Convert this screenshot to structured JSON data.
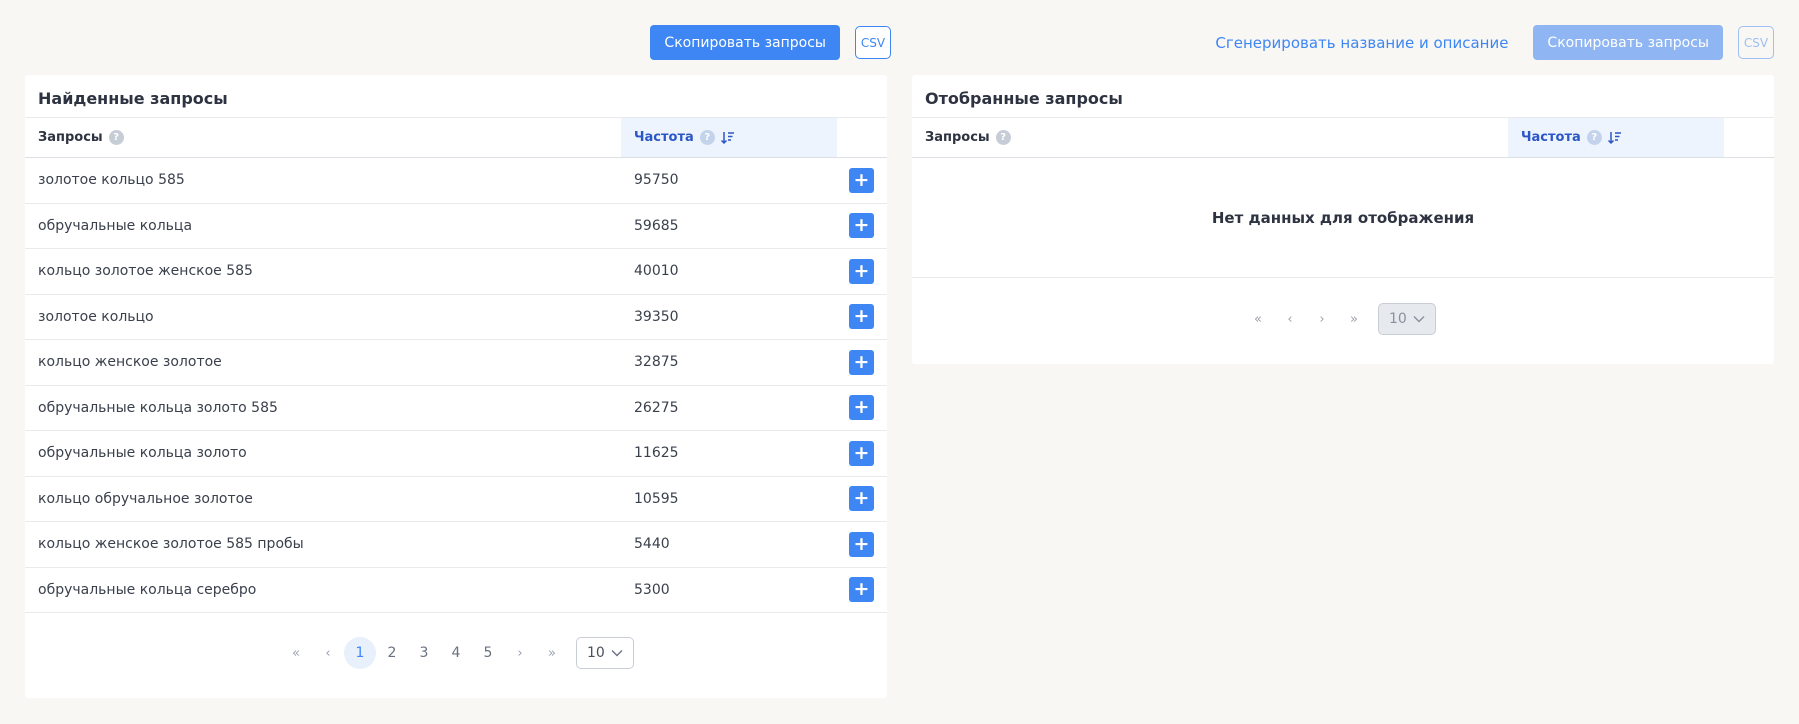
{
  "left_toolbar": {
    "copy_label": "Скопировать запросы",
    "csv_label": "CSV"
  },
  "right_toolbar": {
    "generate_label": "Сгенерировать название и описание",
    "copy_label": "Скопировать запросы",
    "csv_label": "CSV"
  },
  "found": {
    "title": "Найденные запросы",
    "col_query": "Запросы",
    "col_freq": "Частота",
    "rows": [
      {
        "q": "золотое кольцо 585",
        "f": "95750"
      },
      {
        "q": "обручальные кольца",
        "f": "59685"
      },
      {
        "q": "кольцо золотое женское 585",
        "f": "40010"
      },
      {
        "q": "золотое кольцо",
        "f": "39350"
      },
      {
        "q": "кольцо женское золотое",
        "f": "32875"
      },
      {
        "q": "обручальные кольца золото 585",
        "f": "26275"
      },
      {
        "q": "обручальные кольца золото",
        "f": "11625"
      },
      {
        "q": "кольцо обручальное золотое",
        "f": "10595"
      },
      {
        "q": "кольцо женское золотое 585 пробы",
        "f": "5440"
      },
      {
        "q": "обручальные кольца серебро",
        "f": "5300"
      }
    ],
    "pager": {
      "first": "«",
      "prev": "‹",
      "pages": [
        "1",
        "2",
        "3",
        "4",
        "5"
      ],
      "next": "›",
      "last": "»",
      "page_size": "10"
    }
  },
  "selected": {
    "title": "Отобранные запросы",
    "col_query": "Запросы",
    "col_freq": "Частота",
    "empty_text": "Нет данных для отображения",
    "pager": {
      "first": "«",
      "prev": "‹",
      "next": "›",
      "last": "»",
      "page_size": "10"
    }
  },
  "icons": {
    "help": "question-circle-icon",
    "sort": "sort-desc-icon",
    "add": "plus-icon",
    "dropdown": "chevron-down-icon"
  },
  "colors": {
    "accent": "#3d86f3",
    "background": "#f8f7f4"
  }
}
